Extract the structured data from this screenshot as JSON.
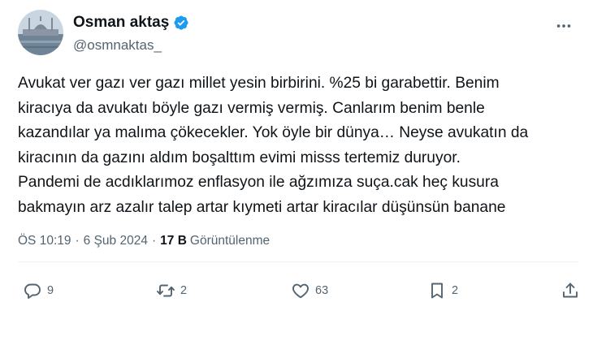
{
  "author": {
    "display_name": "Osman aktaş",
    "handle": "@osmnaktas_",
    "verified": true
  },
  "tweet": {
    "lines": [
      "Avukat ver gazı ver gazı millet yesin birbirini. %25 bi garabettir. Benim",
      "kiracıya da avukatı böyle gazı vermiş vermiş. Canlarım benim benle",
      "kazandılar ya malıma çökecekler. Yok öyle bir dünya… Neyse avukatın da",
      "kiracının da gazını aldım boşalttım evimi misss tertemiz duruyor.",
      "Pandemi de acdıklarımoz enflasyon ile ağzımıza suça.cak heç kusura",
      "bakmayın arz azalır talep artar kıymeti artar kiracılar düşünsün banane"
    ]
  },
  "meta": {
    "time": "ÖS 10:19",
    "date": "6 Şub 2024",
    "separator": "·",
    "views_count": "17 B",
    "views_label": "Görüntülenme"
  },
  "actions": {
    "reply_count": "9",
    "retweet_count": "2",
    "like_count": "63",
    "bookmark_count": "2"
  },
  "colors": {
    "text": "#0f1419",
    "secondary": "#536471",
    "verified": "#1d9bf0",
    "divider": "#eff3f4"
  },
  "icons": [
    "more-icon",
    "verified-badge-icon",
    "reply-icon",
    "retweet-icon",
    "like-icon",
    "bookmark-icon",
    "share-icon"
  ]
}
